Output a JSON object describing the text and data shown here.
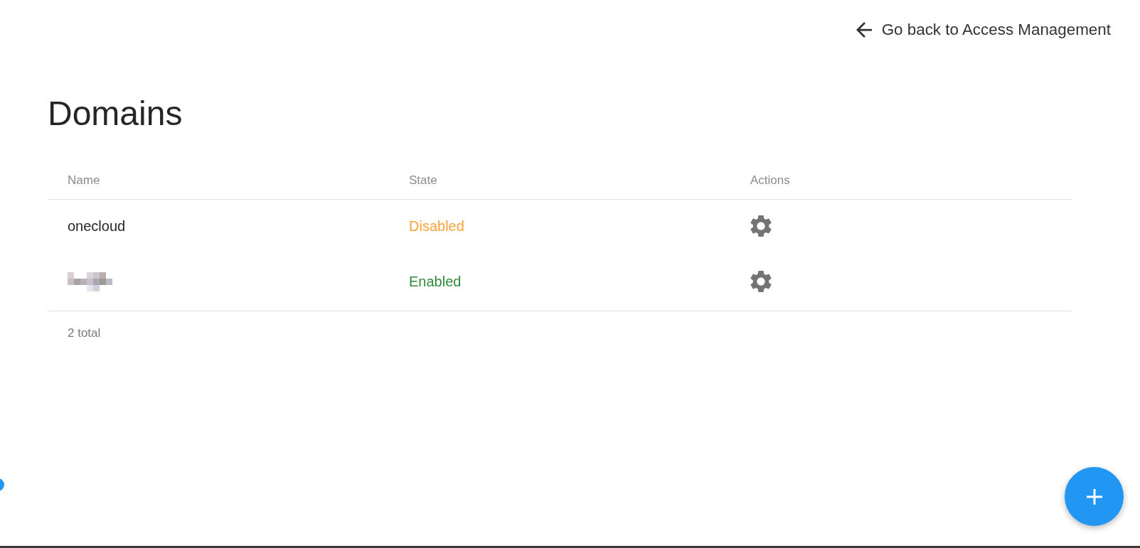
{
  "back_link": {
    "label": "Go back to Access Management"
  },
  "page_title": "Domains",
  "table": {
    "columns": [
      "Name",
      "State",
      "Actions"
    ],
    "rows": [
      {
        "name": "onecloud",
        "name_redacted": false,
        "state": "Disabled",
        "enabled": false
      },
      {
        "name_redacted": true,
        "state": "Enabled",
        "enabled": true
      }
    ],
    "footer": "2 total"
  }
}
